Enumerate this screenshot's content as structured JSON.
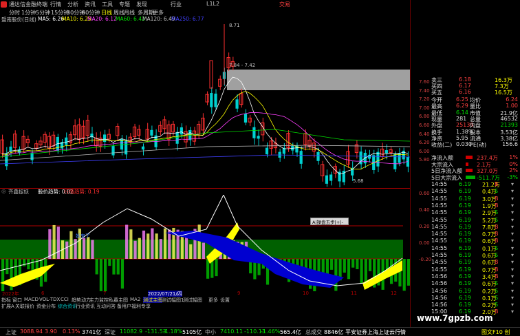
{
  "window": {
    "title": "通达信金融终端",
    "menus": [
      "行情",
      "分析",
      "资讯",
      "工具",
      "专题",
      "发现",
      "行业",
      "L1L2"
    ],
    "broker": "交易"
  },
  "toolbar": {
    "items": [
      "分时",
      "1分钟",
      "5分钟",
      "15分钟",
      "30分钟",
      "60分钟",
      "日线",
      "周线",
      "月线",
      "多周期",
      "更多"
    ],
    "active": 6
  },
  "ma_row": {
    "stock": "暨南股份(日线)",
    "items": [
      {
        "label": "MA5: 6.26",
        "color": "#ffffff"
      },
      {
        "label": "MA10: 6.25",
        "color": "#ffff00"
      },
      {
        "label": "MA20: 6.12",
        "color": "#ff40ff"
      },
      {
        "label": "MA60: 6.42",
        "color": "#00e000"
      },
      {
        "label": "MA120: 6.49",
        "color": "#c0c0c0"
      },
      {
        "label": "MA250: 6.77",
        "color": "#4040ff"
      }
    ]
  },
  "main_axis": [
    "7.60",
    "7.40",
    "7.20",
    "7.00",
    "6.80",
    "6.60",
    "6.40",
    "6.20",
    "6.00",
    "5.80"
  ],
  "annotations": {
    "high": "8.71",
    "range": "7.84 - 7.42",
    "low": "5.68"
  },
  "ind_row": {
    "name": "齐鑫捉妖",
    "items": [
      {
        "label": "股价趋势: 0.02",
        "color": "#ffffff"
      },
      {
        "label": "行情趋势: 0.19",
        "color": "#ff3030"
      }
    ]
  },
  "ind_axis": [
    "0.60",
    "0.40",
    "0.20",
    "0.00",
    "-0.20"
  ],
  "ind_label": "妖来了",
  "popup": "A|操盘五步|+|-",
  "date_bar": [
    "2022年",
    "6",
    "7",
    "2022/07/21/四",
    "9",
    "10",
    "11",
    "12"
  ],
  "bottom_tabs": [
    "指标",
    "窗口",
    "MACD",
    "VOL-TDX",
    "CCI",
    "趋势动力",
    "主力监控",
    "私募主图",
    "MA2",
    "测试主图",
    "测试幅图1",
    "测试幅图",
    "更多",
    "设置"
  ],
  "bottom_tabs_sel": 9,
  "bottom_tabs2": [
    "扩展A",
    "关联报价",
    "资金分布",
    "综合资讯",
    "行业资讯",
    "互动问答",
    "备用户福利专享"
  ],
  "right_panel": {
    "top_axis": [
      "7.60",
      "7.40",
      "7.20",
      "7.00",
      "6.80",
      "6.60",
      "6.40",
      "6.20",
      "6.00",
      "5.80"
    ],
    "quotes": [
      {
        "l": "卖三",
        "v": "6.18",
        "n": "16.3万"
      },
      {
        "l": "买四",
        "v": "6.17",
        "n": "7.3万"
      },
      {
        "l": "买五",
        "v": "6.16",
        "n": "16.5万"
      }
    ],
    "stats": [
      {
        "l1": "今开",
        "v1": "6.25",
        "l2": "均价",
        "v2": "6.24"
      },
      {
        "l1": "最高",
        "v1": "6.29",
        "l2": "量比",
        "v2": "1.00"
      },
      {
        "l1": "最低",
        "v1": "6.14",
        "l2": "市值",
        "v2": "21.9亿"
      },
      {
        "l1": "现量",
        "v1": "281",
        "l2": "总量",
        "v2": "46532"
      },
      {
        "l1": "外盘",
        "v1": "25139",
        "l2": "内盘",
        "v2": "21393"
      },
      {
        "l1": "换手",
        "v1": "1.38%",
        "l2": "股本",
        "v2": "3.53亿"
      },
      {
        "l1": "净资",
        "v1": "5.95",
        "l2": "流通",
        "v2": "3.38亿"
      },
      {
        "l1": "收益(二)",
        "v1": "0.030",
        "l2": "PE(动)",
        "v2": "156.6"
      }
    ],
    "flows": [
      {
        "l": "净流入额",
        "v": "237.4万",
        "p": "1%"
      },
      {
        "l": "大宗流入",
        "v": "2.1万",
        "p": "0%"
      },
      {
        "l": "5日净流入额",
        "v": "327.0万",
        "p": "2%"
      },
      {
        "l": "5日大宗流入",
        "v": "-511.7万",
        "p": "-3%"
      }
    ],
    "ticks": [
      {
        "t": "14:55",
        "p": "6.19",
        "v": "21.2万",
        "s": "B"
      },
      {
        "t": "14:55",
        "p": "6.19",
        "v": "0.4万",
        "s": "S"
      },
      {
        "t": "14:55",
        "p": "6.19",
        "v": "3.0万",
        "s": "B"
      },
      {
        "t": "14:55",
        "p": "6.19",
        "v": "1.9万",
        "s": "B"
      },
      {
        "t": "14:55",
        "p": "6.19",
        "v": "2.9万",
        "s": "S"
      },
      {
        "t": "14:55",
        "p": "6.19",
        "v": "5.2万",
        "s": "S"
      },
      {
        "t": "14:55",
        "p": "6.19",
        "v": "7.8万",
        "s": "B"
      },
      {
        "t": "14:55",
        "p": "6.19",
        "v": "0.7万",
        "s": "B"
      },
      {
        "t": "14:55",
        "p": "6.19",
        "v": "0.6万",
        "s": "B"
      },
      {
        "t": "14:55",
        "p": "6.19",
        "v": "0.1万",
        "s": "S"
      },
      {
        "t": "14:55",
        "p": "6.19",
        "v": "0.6万",
        "s": "S"
      },
      {
        "t": "14:55",
        "p": "6.19",
        "v": "0.6万",
        "s": "B"
      },
      {
        "t": "14:55",
        "p": "6.19",
        "v": "0.7万",
        "s": "B"
      },
      {
        "t": "14:56",
        "p": "6.19",
        "v": "3.4万",
        "s": "B"
      },
      {
        "t": "14:56",
        "p": "6.19",
        "v": "0.6万",
        "s": "S"
      },
      {
        "t": "14:56",
        "p": "6.19",
        "v": "0.2万",
        "s": "S"
      },
      {
        "t": "14:56",
        "p": "6.19",
        "v": "0.1万",
        "s": "S"
      },
      {
        "t": "14:56",
        "p": "6.19",
        "v": "0.2万",
        "s": "S"
      },
      {
        "t": "15:00",
        "p": "6.19",
        "v": "2.0万",
        "s": "B"
      }
    ]
  },
  "statusbar": {
    "items": [
      {
        "text": "上证",
        "color": "#c0c0c0"
      },
      {
        "text": "3088.94",
        "color": "#ff4040"
      },
      {
        "text": "3.90",
        "color": "#ff4040"
      },
      {
        "text": "0.13%",
        "color": "#ff4040"
      },
      {
        "text": "3741亿",
        "color": "#ffffff"
      },
      {
        "text": "深证",
        "color": "#c0c0c0"
      },
      {
        "text": "11082.9",
        "color": "#00e000"
      },
      {
        "text": "-131.53",
        "color": "#00e000"
      },
      {
        "text": "-1.18%",
        "color": "#00e000"
      },
      {
        "text": "5105亿",
        "color": "#ffffff"
      },
      {
        "text": "中小",
        "color": "#c0c0c0"
      },
      {
        "text": "7410.11",
        "color": "#00e000"
      },
      {
        "text": "-110.13",
        "color": "#00e000"
      },
      {
        "text": "-1.46%",
        "color": "#00e000"
      },
      {
        "text": "565.4亿",
        "color": "#ffffff"
      },
      {
        "text": "总成交",
        "color": "#c0c0c0"
      },
      {
        "text": "8846亿",
        "color": "#ffffff"
      },
      {
        "text": "平安证券上海上证云行情",
        "color": "#ffffff"
      }
    ]
  },
  "footer_right": "图文F10 创",
  "watermark": "www.7gpzb.com"
}
